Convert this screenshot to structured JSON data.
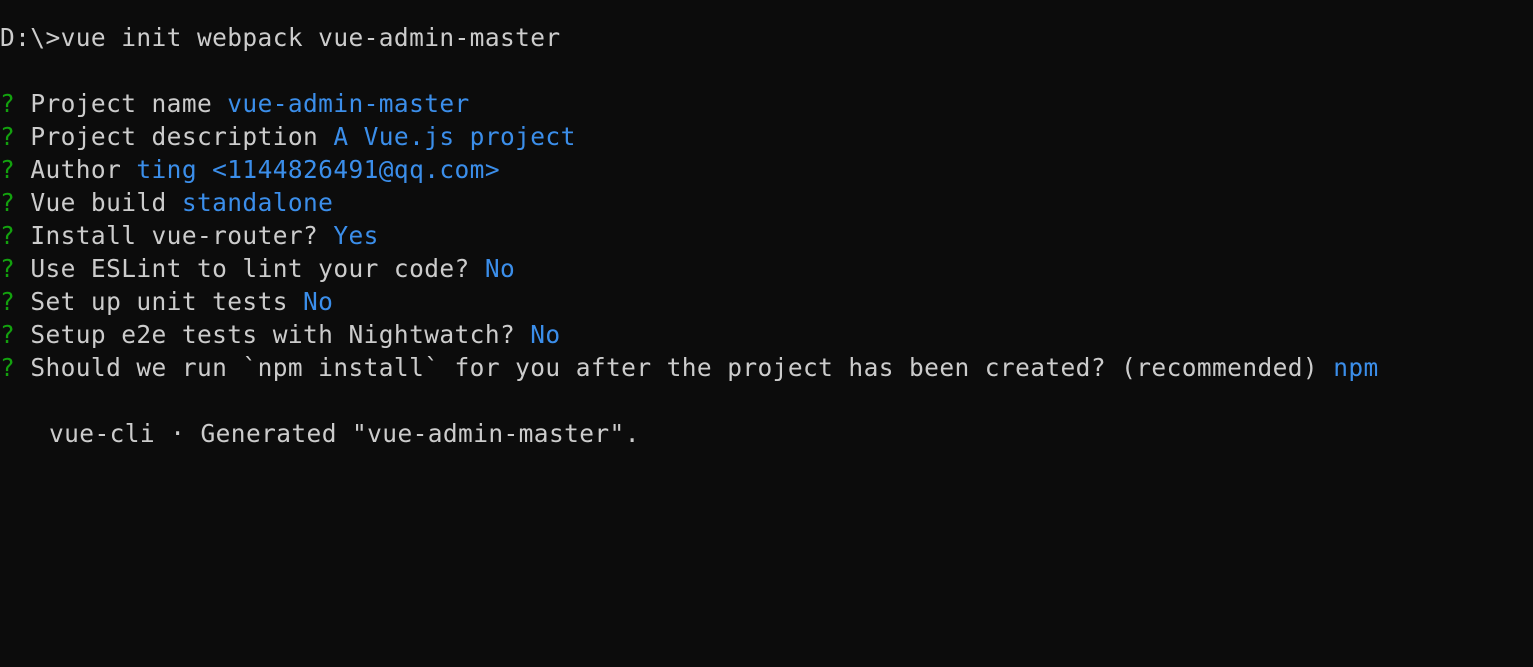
{
  "command": {
    "prompt": "D:\\>",
    "text": "vue init webpack vue-admin-master"
  },
  "questions": [
    {
      "marker": "?",
      "question": "Project name",
      "answer": "vue-admin-master"
    },
    {
      "marker": "?",
      "question": "Project description",
      "answer": "A Vue.js project"
    },
    {
      "marker": "?",
      "question": "Author",
      "answer": "ting <1144826491@qq.com>"
    },
    {
      "marker": "?",
      "question": "Vue build",
      "answer": "standalone"
    },
    {
      "marker": "?",
      "question": "Install vue-router?",
      "answer": "Yes"
    },
    {
      "marker": "?",
      "question": "Use ESLint to lint your code?",
      "answer": "No"
    },
    {
      "marker": "?",
      "question": "Set up unit tests",
      "answer": "No"
    },
    {
      "marker": "?",
      "question": "Setup e2e tests with Nightwatch?",
      "answer": "No"
    },
    {
      "marker": "?",
      "question": "Should we run `npm install` for you after the project has been created? (recommended)",
      "answer": "npm"
    }
  ],
  "result": {
    "text": "vue-cli · Generated \"vue-admin-master\"."
  },
  "colors": {
    "background": "#0c0c0c",
    "foreground": "#cccccc",
    "marker": "#13a10e",
    "answer": "#3b8eea"
  }
}
